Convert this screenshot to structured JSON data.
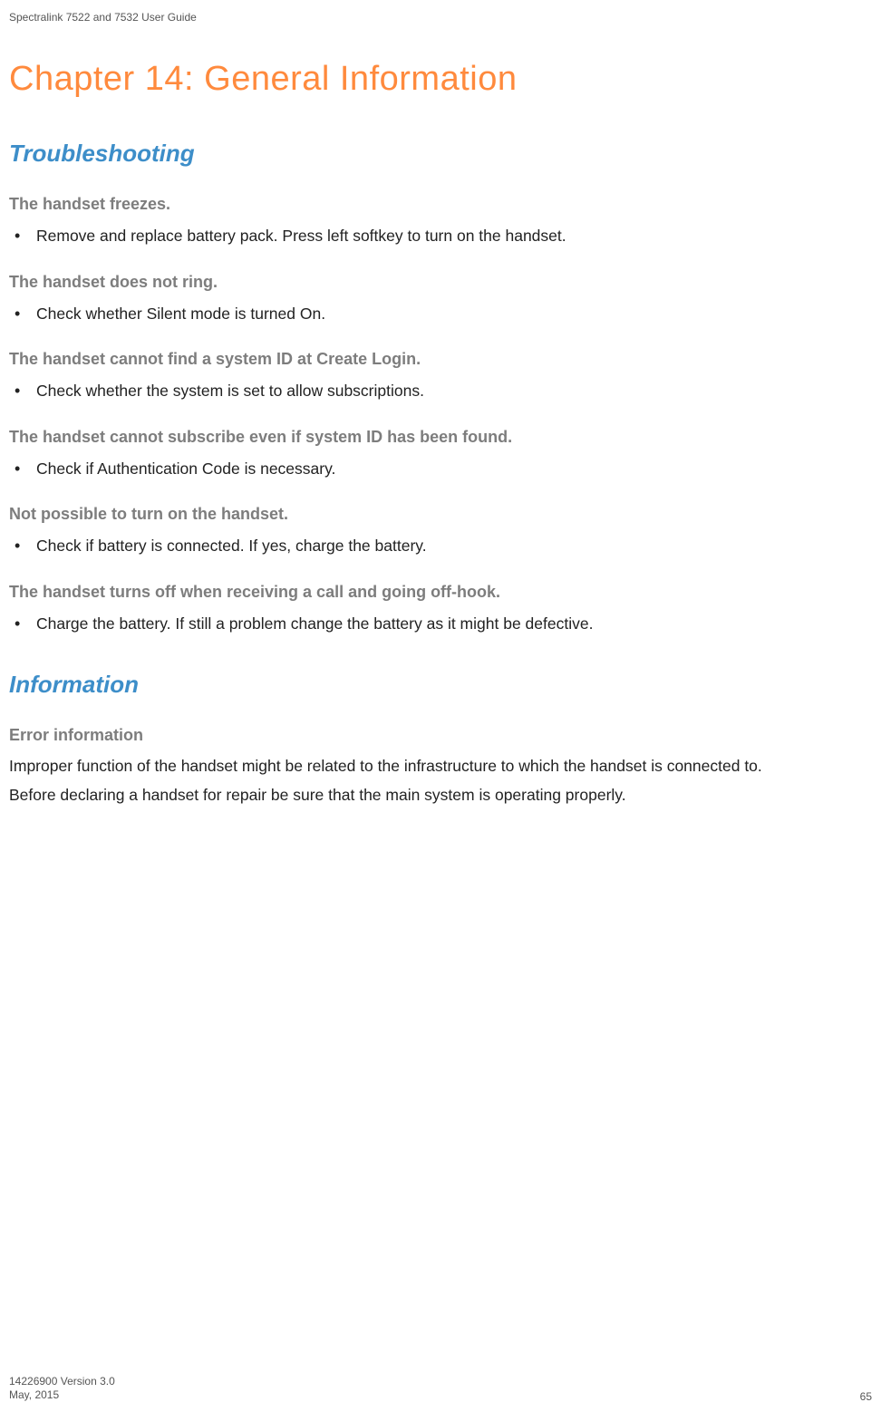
{
  "header": {
    "docTitle": "Spectralink 7522 and 7532 User Guide"
  },
  "chapter": {
    "title": "Chapter 14: General Information"
  },
  "sections": {
    "troubleshooting": {
      "title": "Troubleshooting",
      "items": [
        {
          "heading": "The handset freezes.",
          "bullet": "Remove and replace battery pack. Press left softkey to turn on the handset."
        },
        {
          "heading": "The handset does not ring.",
          "bullet": "Check whether Silent mode is turned On."
        },
        {
          "heading": "The handset cannot find a system ID at Create Login.",
          "bullet": "Check whether the system is set to allow subscriptions."
        },
        {
          "heading": "The handset cannot subscribe even if system ID has been found.",
          "bullet": "Check if Authentication Code is necessary."
        },
        {
          "heading": "Not possible to turn on the handset.",
          "bullet": "Check if battery is connected. If yes, charge the battery."
        },
        {
          "heading": "The handset turns off when receiving a call and going off-hook.",
          "bullet": "Charge the battery. If still a problem change the battery as it might be defective."
        }
      ]
    },
    "information": {
      "title": "Information",
      "errorHeading": "Error information",
      "para1": "Improper function of the handset might be related to the infrastructure to which the handset is connected to.",
      "para2": "Before declaring a handset for repair be sure that the main system is operating properly."
    }
  },
  "footer": {
    "version": "14226900 Version 3.0",
    "date": "May, 2015",
    "page": "65"
  }
}
